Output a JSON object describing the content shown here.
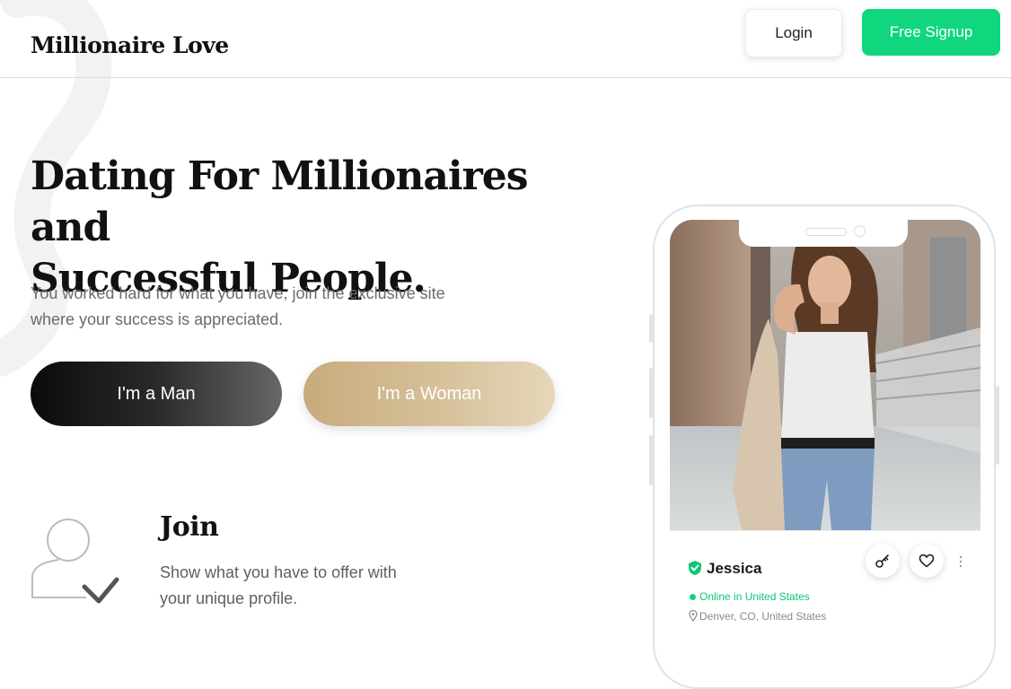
{
  "header": {
    "logo": "Millionaire Love",
    "login_label": "Login",
    "signup_label": "Free Signup",
    "signup_color": "#10d67e"
  },
  "hero": {
    "title_line1": "Dating For Millionaires and",
    "title_line2": "Successful People.",
    "subtitle_line1": "You worked hard for what you have, join the exclusive site",
    "subtitle_line2": "where your success is appreciated.",
    "man_button": "I'm a Man",
    "woman_button": "I'm a Woman",
    "woman_button_color": "#d4bc92"
  },
  "feature": {
    "title": "Join",
    "desc_line1": "Show what you have to offer with",
    "desc_line2": "your unique profile.",
    "icon": "user-check-icon"
  },
  "profile_card": {
    "name": "Jessica",
    "online_status": "Online in United States",
    "location": "Denver, CO, United States",
    "actions": [
      "key-icon",
      "heart-icon",
      "more-icon"
    ]
  }
}
